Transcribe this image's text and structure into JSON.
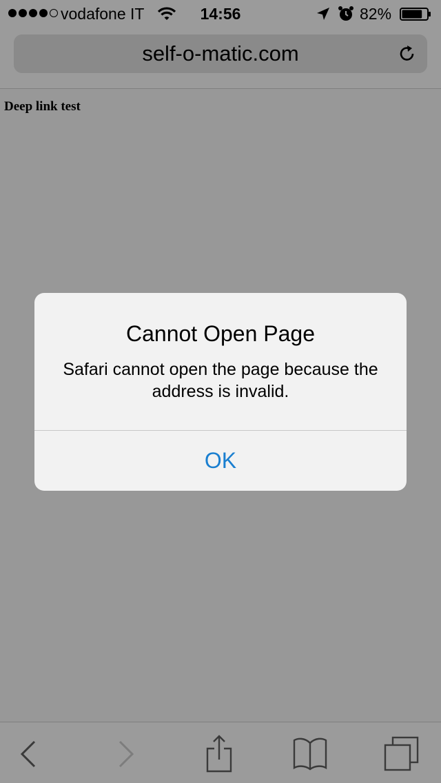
{
  "status_bar": {
    "carrier": "vodafone IT",
    "time": "14:56",
    "battery_percent": "82%",
    "signal_bars_filled": 4,
    "signal_bars_total": 5,
    "battery_level": 0.82,
    "icons": [
      "wifi-icon",
      "location-arrow-icon",
      "alarm-icon",
      "battery-icon"
    ]
  },
  "url_bar": {
    "url": "self-o-matic.com",
    "reload_icon": "reload-icon"
  },
  "page": {
    "heading": "Deep link test"
  },
  "alert": {
    "title": "Cannot Open Page",
    "message": "Safari cannot open the page because the address is invalid.",
    "ok_label": "OK"
  },
  "toolbar": {
    "items": [
      "back-icon",
      "forward-icon",
      "share-icon",
      "bookmarks-icon",
      "tabs-icon"
    ]
  },
  "colors": {
    "background": "#989898",
    "alert_background": "#f2f2f2",
    "accent": "#1a7fd0"
  }
}
